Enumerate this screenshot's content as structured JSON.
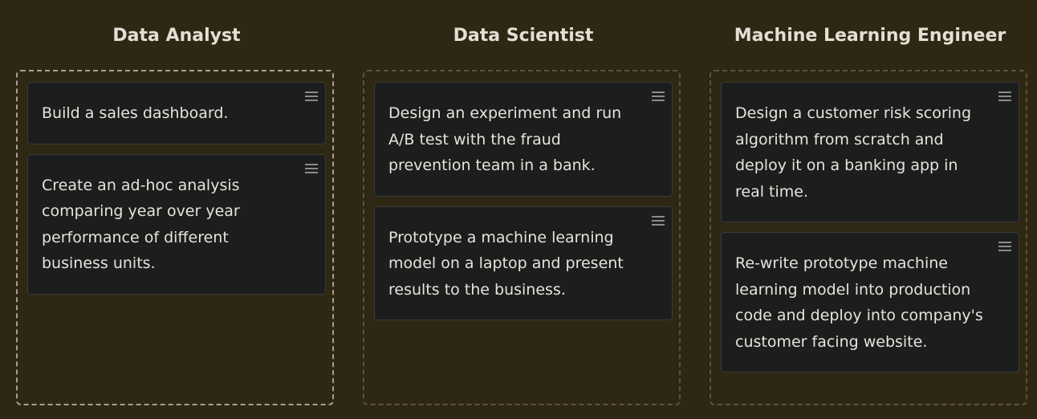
{
  "columns": [
    {
      "title": "Data Analyst",
      "cards": [
        {
          "text": "Build a sales dashboard."
        },
        {
          "text": "Create an ad-hoc analysis comparing year over year performance of different business units."
        }
      ]
    },
    {
      "title": "Data Scientist",
      "cards": [
        {
          "text": "Design an experiment and run A/B test with the fraud prevention team in a bank."
        },
        {
          "text": "Prototype a machine learning model on a laptop and present results to the business."
        }
      ]
    },
    {
      "title": "Machine Learning Engineer",
      "cards": [
        {
          "text": "Design a customer risk scoring algorithm from scratch and deploy it on a banking app in real time."
        },
        {
          "text": "Re-write prototype machine learning model into production code and deploy into company's customer facing website."
        }
      ]
    }
  ],
  "icons": {
    "drag_handle": "drag-handle-icon"
  },
  "colors": {
    "background": "#2e2714",
    "card": "#1c1d1d",
    "text": "#e7e3da",
    "active_border": "#a7a191",
    "idle_border": "#5d5439"
  }
}
